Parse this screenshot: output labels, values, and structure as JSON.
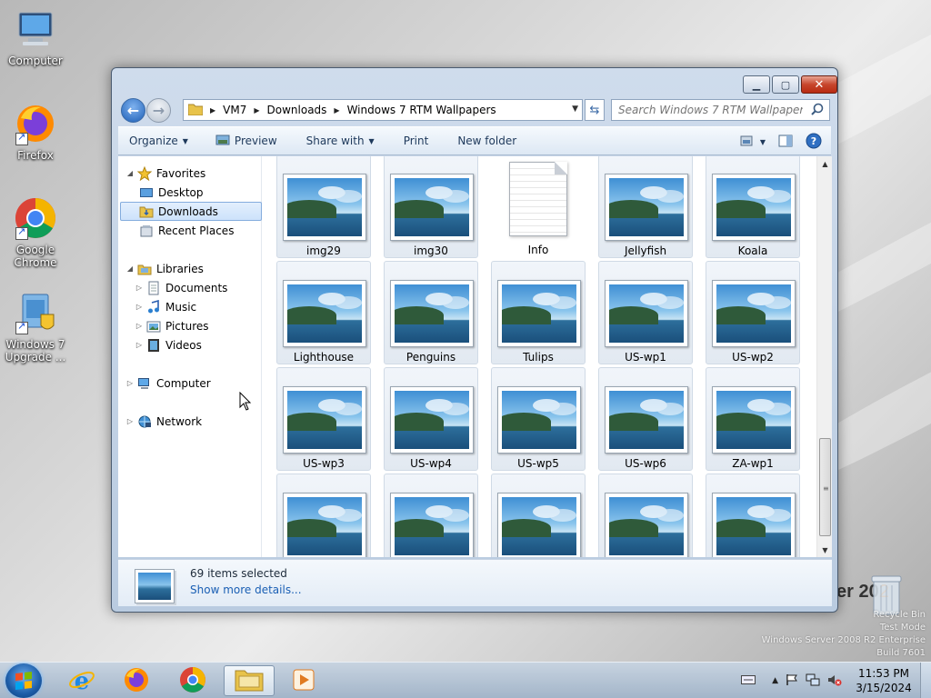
{
  "desktop": {
    "icons": [
      {
        "label": "Computer",
        "icon": "computer-icon"
      },
      {
        "label": "Firefox",
        "icon": "firefox-icon"
      },
      {
        "label": "Google Chrome",
        "icon": "chrome-icon"
      },
      {
        "label": "Windows 7 Upgrade ...",
        "icon": "windows7-upgrade-icon"
      }
    ],
    "server_text": "er 20",
    "server_suffix": "2",
    "recycle_bin_label": "Recycle Bin",
    "watermark": {
      "line1": "Test Mode",
      "line2": "Windows Server 2008 R2 Enterprise",
      "line3": "Build 7601"
    }
  },
  "explorer": {
    "breadcrumb": [
      "VM7",
      "Downloads",
      "Windows 7 RTM Wallpapers"
    ],
    "search_placeholder": "Search Windows 7 RTM Wallpapers",
    "toolbar": {
      "organize": "Organize",
      "preview": "Preview",
      "share_with": "Share with",
      "print": "Print",
      "new_folder": "New folder"
    },
    "nav": {
      "favorites": "Favorites",
      "desktop": "Desktop",
      "downloads": "Downloads",
      "recent_places": "Recent Places",
      "libraries": "Libraries",
      "documents": "Documents",
      "music": "Music",
      "pictures": "Pictures",
      "videos": "Videos",
      "computer": "Computer",
      "network": "Network"
    },
    "files": [
      {
        "name": "img29",
        "type": "image"
      },
      {
        "name": "img30",
        "type": "image"
      },
      {
        "name": "Info",
        "type": "text"
      },
      {
        "name": "Jellyfish",
        "type": "image"
      },
      {
        "name": "Koala",
        "type": "image"
      },
      {
        "name": "Lighthouse",
        "type": "image"
      },
      {
        "name": "Penguins",
        "type": "image"
      },
      {
        "name": "Tulips",
        "type": "image"
      },
      {
        "name": "US-wp1",
        "type": "image"
      },
      {
        "name": "US-wp2",
        "type": "image"
      },
      {
        "name": "US-wp3",
        "type": "image"
      },
      {
        "name": "US-wp4",
        "type": "image"
      },
      {
        "name": "US-wp5",
        "type": "image"
      },
      {
        "name": "US-wp6",
        "type": "image"
      },
      {
        "name": "ZA-wp1",
        "type": "image"
      },
      {
        "name": "",
        "type": "image"
      },
      {
        "name": "",
        "type": "image"
      },
      {
        "name": "",
        "type": "image"
      },
      {
        "name": "",
        "type": "image"
      },
      {
        "name": "",
        "type": "image"
      }
    ],
    "status": {
      "count": "69 items selected",
      "details_link": "Show more details..."
    }
  },
  "taskbar": {
    "pinned": [
      "internet-explorer-icon",
      "firefox-icon",
      "chrome-icon",
      "windows-explorer-icon",
      "media-player-icon"
    ],
    "time": "11:53 PM",
    "date": "3/15/2024"
  },
  "colors": {
    "accent": "#1a5fb4",
    "selection": "#cde2fb",
    "close_button": "#c7452c"
  }
}
